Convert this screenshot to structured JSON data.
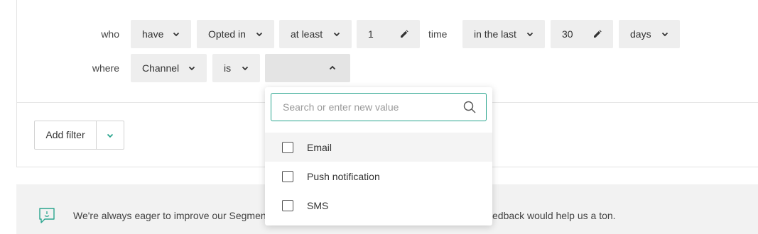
{
  "filter_row1": {
    "label": "who",
    "have": "have",
    "event": "Opted in",
    "comparator": "at least",
    "count": "1",
    "count_unit": "time",
    "window": "in the last",
    "days_value": "30",
    "days_unit": "days"
  },
  "filter_row2": {
    "label": "where",
    "property": "Channel",
    "operator": "is",
    "value": ""
  },
  "add_filter": {
    "label": "Add filter"
  },
  "dropdown": {
    "search_placeholder": "Search or enter new value",
    "options": [
      {
        "label": "Email",
        "checked": false
      },
      {
        "label": "Push notification",
        "checked": false
      },
      {
        "label": "SMS",
        "checked": false
      }
    ]
  },
  "feedback": {
    "text_left": "We're always eager to improve our Segmenta",
    "text_right": "edback would help us a ton."
  },
  "colors": {
    "accent": "#2aa58e",
    "pill_bg": "#eeeeee",
    "feedback_bg": "#f2f2f2"
  }
}
